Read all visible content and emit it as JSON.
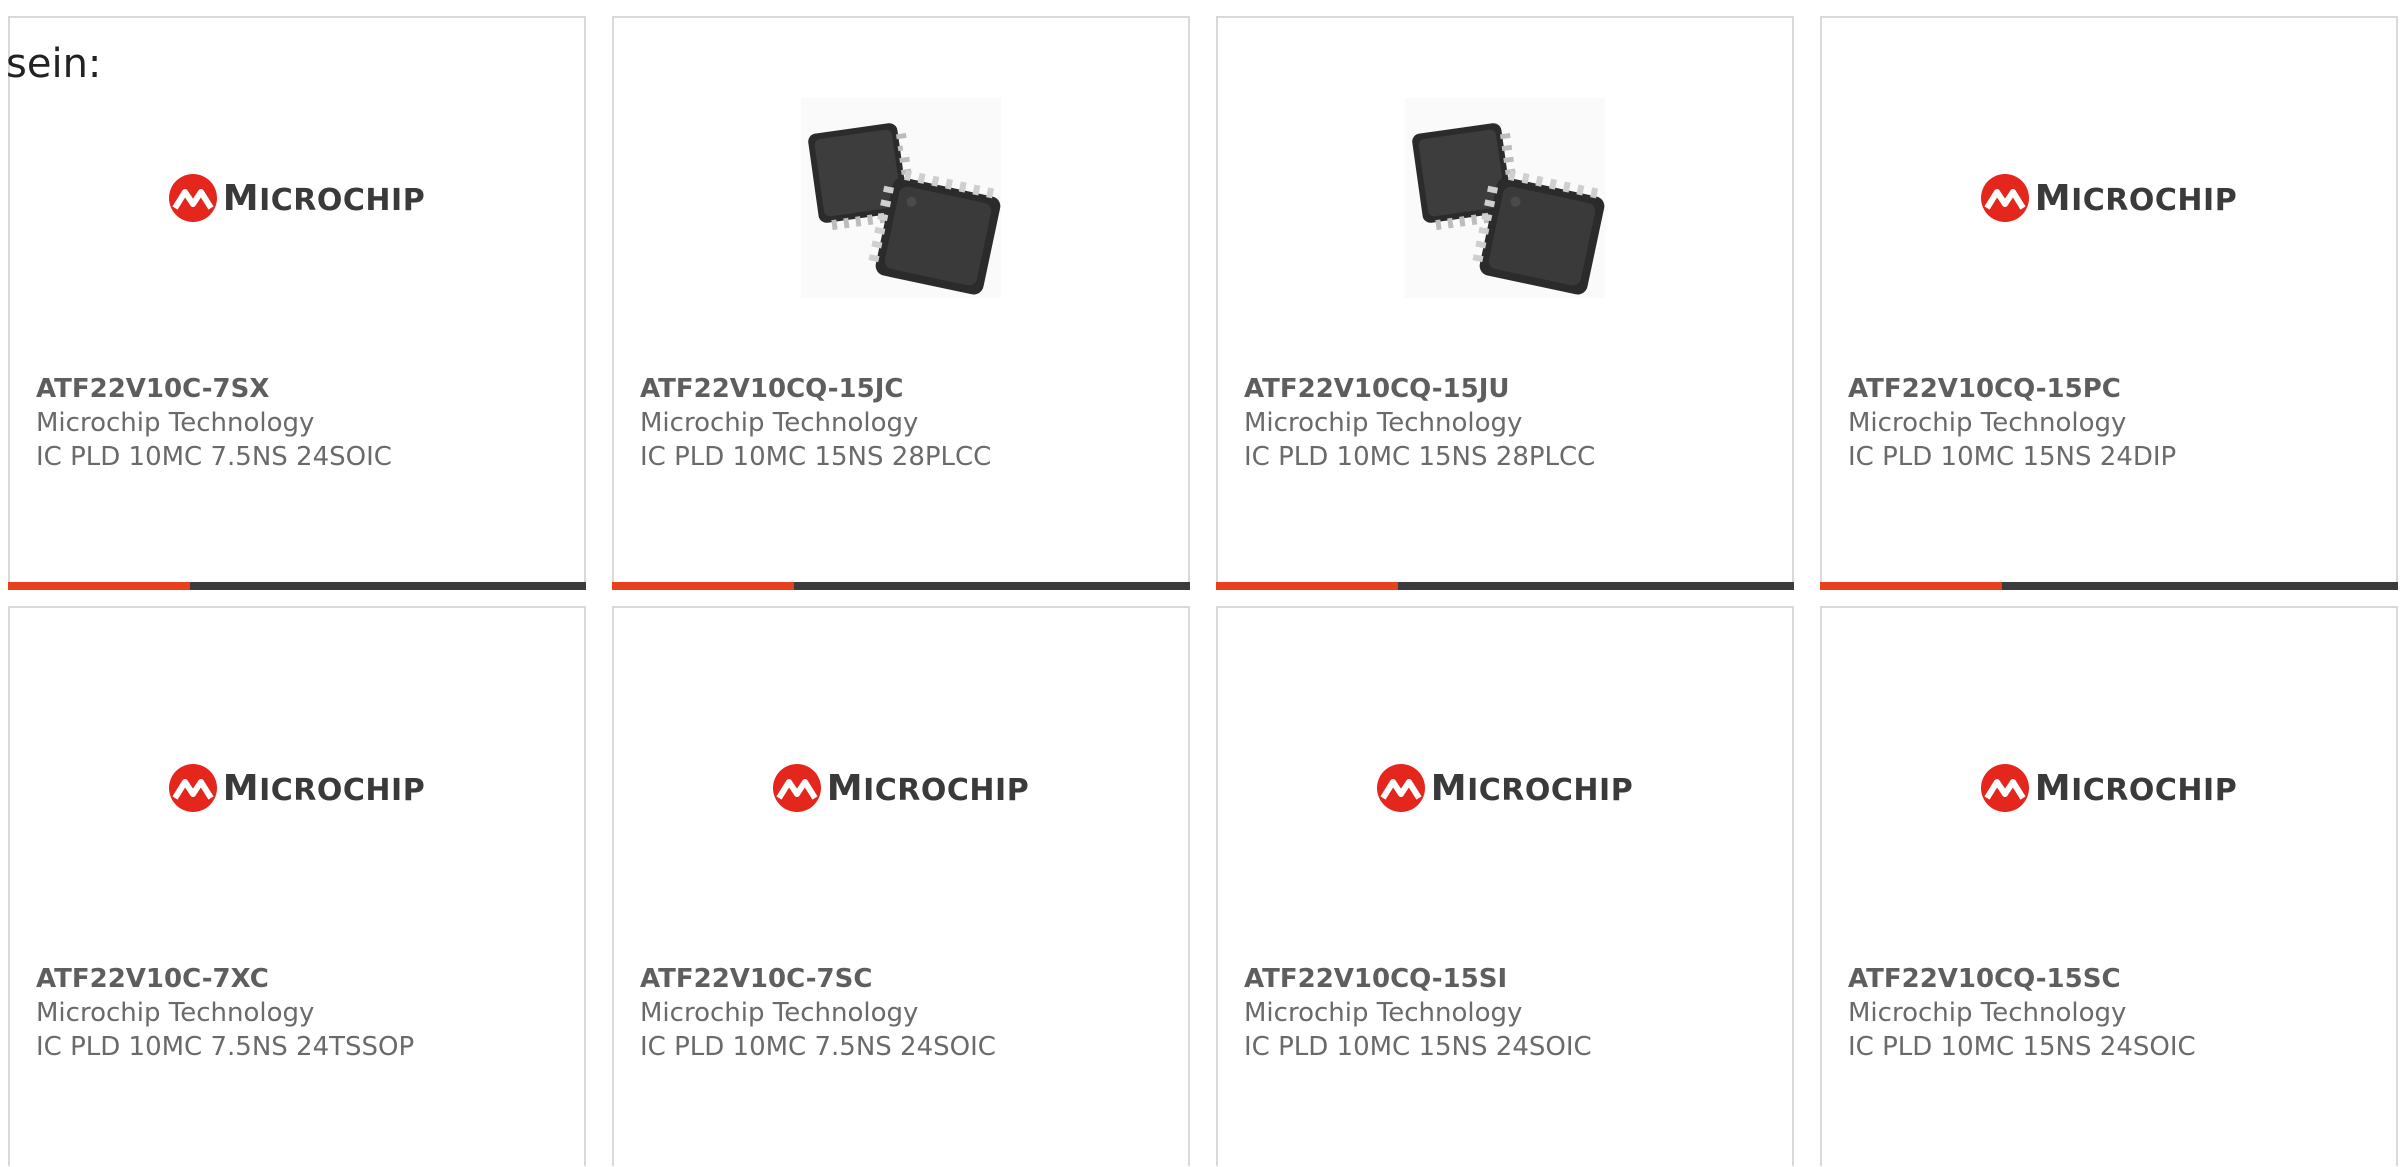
{
  "intro_text": "sein:",
  "logo": {
    "first": "M",
    "rest": "ICROCHIP",
    "color": "#e4261c"
  },
  "accent_color": "#e8401c",
  "cards": [
    {
      "part_number": "ATF22V10C-7SX",
      "manufacturer": "Microchip Technology",
      "description": "IC PLD 10MC 7.5NS 24SOIC",
      "image": "microchip-logo"
    },
    {
      "part_number": "ATF22V10CQ-15JC",
      "manufacturer": "Microchip Technology",
      "description": "IC PLD 10MC 15NS 28PLCC",
      "image": "plcc-chip-photo"
    },
    {
      "part_number": "ATF22V10CQ-15JU",
      "manufacturer": "Microchip Technology",
      "description": "IC PLD 10MC 15NS 28PLCC",
      "image": "plcc-chip-photo"
    },
    {
      "part_number": "ATF22V10CQ-15PC",
      "manufacturer": "Microchip Technology",
      "description": "IC PLD 10MC 15NS 24DIP",
      "image": "microchip-logo"
    },
    {
      "part_number": "ATF22V10C-7XC",
      "manufacturer": "Microchip Technology",
      "description": "IC PLD 10MC 7.5NS 24TSSOP",
      "image": "microchip-logo"
    },
    {
      "part_number": "ATF22V10C-7SC",
      "manufacturer": "Microchip Technology",
      "description": "IC PLD 10MC 7.5NS 24SOIC",
      "image": "microchip-logo"
    },
    {
      "part_number": "ATF22V10CQ-15SI",
      "manufacturer": "Microchip Technology",
      "description": "IC PLD 10MC 15NS 24SOIC",
      "image": "microchip-logo"
    },
    {
      "part_number": "ATF22V10CQ-15SC",
      "manufacturer": "Microchip Technology",
      "description": "IC PLD 10MC 15NS 24SOIC",
      "image": "microchip-logo"
    }
  ]
}
